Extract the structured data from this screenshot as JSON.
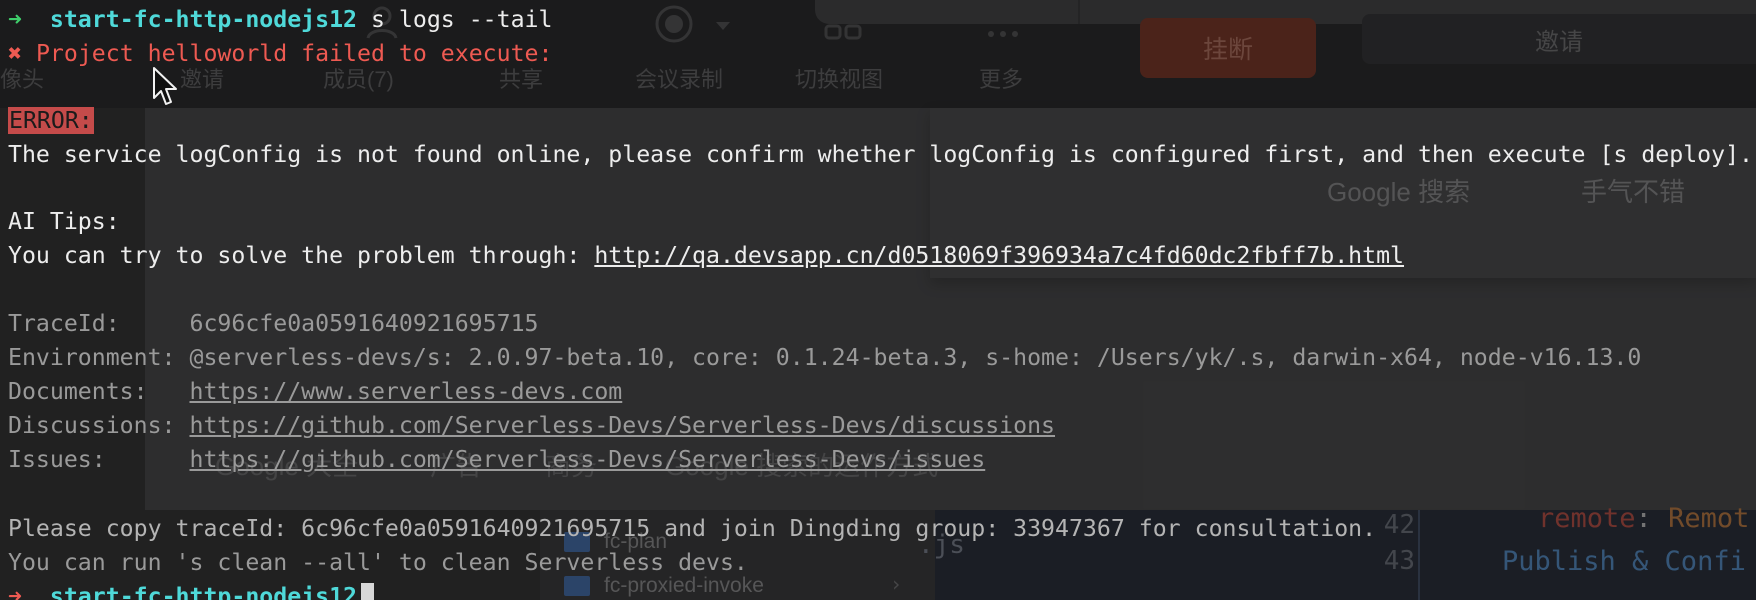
{
  "meeting_toolbar": {
    "items": [
      {
        "label": "像头"
      },
      {
        "label": "邀请"
      },
      {
        "label": "成员(7)"
      },
      {
        "label": "共享"
      },
      {
        "label": "会议录制"
      },
      {
        "label": "切换视图"
      },
      {
        "label": "更多"
      }
    ],
    "hangup_label": "挂断",
    "invite_label": "邀请"
  },
  "browser": {
    "buttons": [
      "Google 搜索",
      "手气不错"
    ],
    "footer_links": [
      "Google 大全",
      "广告",
      "商务",
      "Google 搜索的运作方式"
    ]
  },
  "file_tree": {
    "items": [
      "fc-plan",
      "fc-proxied-invoke"
    ],
    "partial_text": ".js"
  },
  "editor": {
    "line_numbers": [
      "42",
      "43"
    ],
    "lines": [
      {
        "key": "remote",
        "sep": ": ",
        "value": "Remot"
      },
      {
        "text": "Publish & Confi"
      }
    ]
  },
  "terminal": {
    "prompt_arrow": "➜",
    "cwd": "start-fc-http-nodejs12",
    "command": "s logs --tail",
    "failure_mark": "✖",
    "failure_message": "Project helloworld failed to execute:",
    "error_label": "ERROR:",
    "error_message": "The service logConfig is not found online, please confirm whether logConfig is configured first, and then execute [s deploy].",
    "ai_tips_title": "AI Tips:",
    "ai_tips_prefix": "You can try to solve the problem through: ",
    "ai_tips_url": "http://qa.devsapp.cn/d0518069f396934a7c4fd60dc2fbff7b.html",
    "info": [
      {
        "label": "TraceId:     ",
        "value": "6c96cfe0a0591640921695715",
        "is_link": false
      },
      {
        "label": "Environment: ",
        "value": "@serverless-devs/s: 2.0.97-beta.10, core: 0.1.24-beta.3, s-home: /Users/yk/.s, darwin-x64, node-v16.13.0",
        "is_link": false
      },
      {
        "label": "Documents:   ",
        "value": "https://www.serverless-devs.com",
        "is_link": true
      },
      {
        "label": "Discussions: ",
        "value": "https://github.com/Serverless-Devs/Serverless-Devs/discussions",
        "is_link": true
      },
      {
        "label": "Issues:      ",
        "value": "https://github.com/Serverless-Devs/Serverless-Devs/issues",
        "is_link": true
      }
    ],
    "copy_trace_message": "Please copy traceId: 6c96cfe0a0591640921695715 and join Dingding group: 33947367 for consultation.",
    "clean_message": "You can run 's clean --all' to clean Serverless devs.",
    "final_prompt_cwd": "start-fc-http-nodejs12"
  },
  "colors": {
    "prompt_green": "#3fce6b",
    "error_red": "#ee5a52",
    "cwd_cyan": "#4fd9d9",
    "error_badge": "#c54b4a"
  },
  "icons": [
    "mouse-pointer-icon",
    "folder-icon",
    "chevron-right-icon",
    "record-icon",
    "view-icon",
    "more-icon",
    "member-icon"
  ]
}
